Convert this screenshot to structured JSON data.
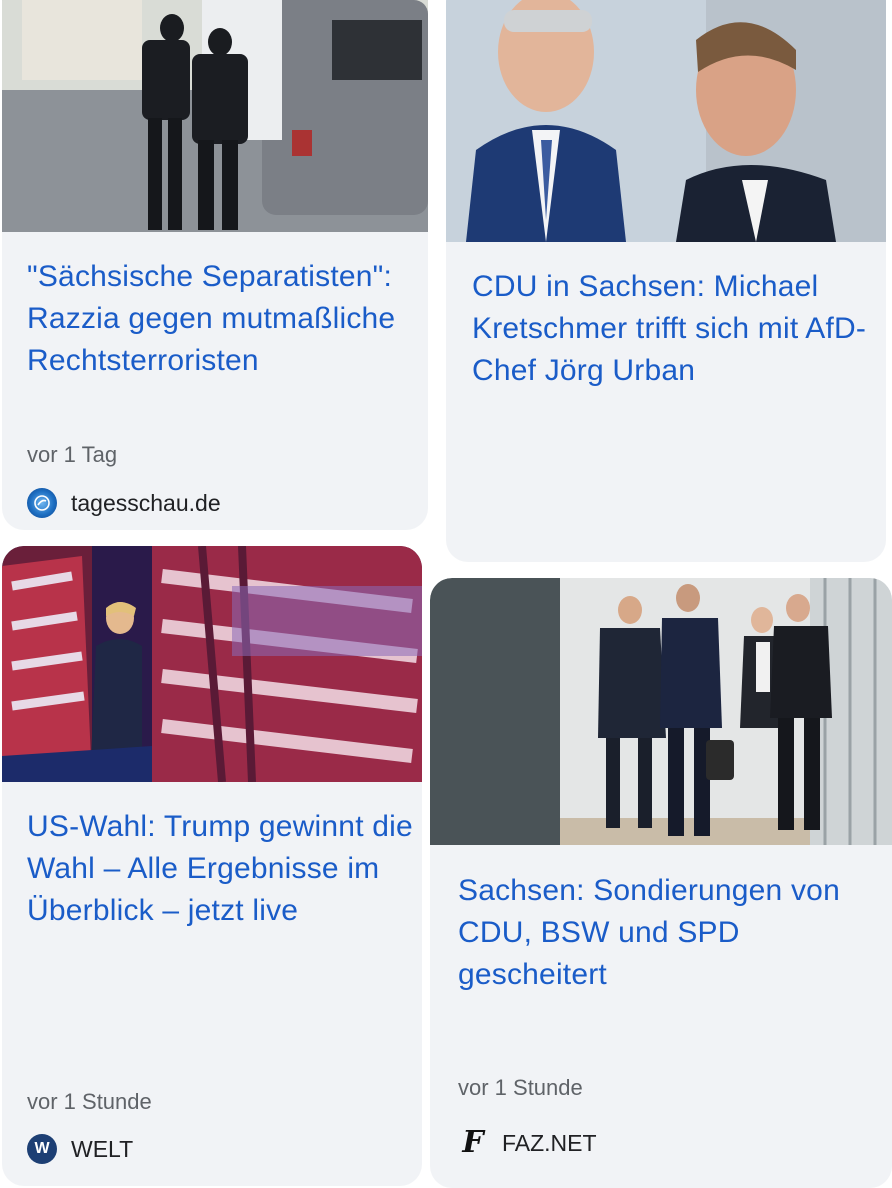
{
  "cards": [
    {
      "headline": "\"Sächsische Separatisten\": Razzia gegen mutmaßliche Rechtsterroristen",
      "time": "vor 1 Tag",
      "source": "tagesschau.de",
      "logo_icon": "tagesschau-globe-icon"
    },
    {
      "headline": "CDU in Sachsen: Michael Kretschmer trifft sich mit AfD-Chef Jörg Urban"
    },
    {
      "headline": "US-Wahl: Trump gewinnt die Wahl – Alle Ergebnisse im Überblick – jetzt live",
      "time": "vor 1 Stunde",
      "source": "WELT",
      "logo_text": "W",
      "logo_icon": "welt-logo-icon"
    },
    {
      "headline": "Sachsen: Sondierungen von CDU, BSW und SPD gescheitert",
      "time": "vor 1 Stunde",
      "source": "FAZ.NET",
      "logo_text": "F",
      "logo_icon": "faz-logo-icon"
    }
  ],
  "colors": {
    "headline": "#1a5cc8",
    "card_background": "#f1f3f6",
    "meta_text": "#5f6368"
  }
}
